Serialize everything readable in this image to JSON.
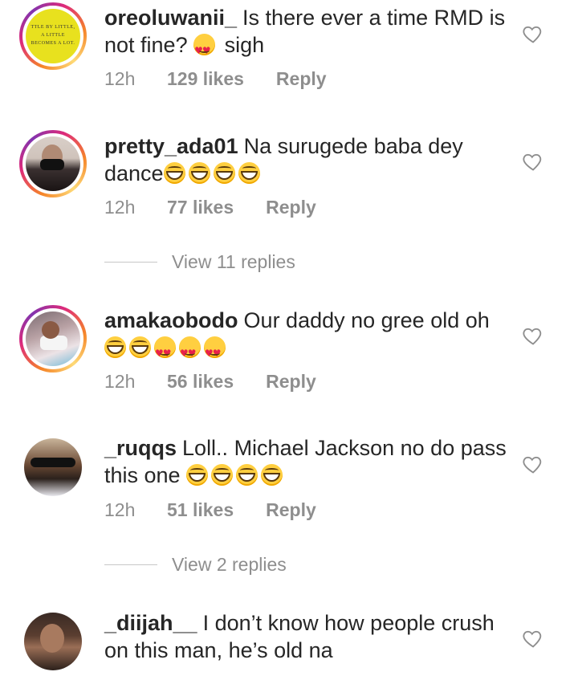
{
  "comments": [
    {
      "username": "oreoluwanii_",
      "text": "Is there ever a time RMD is not fine?",
      "text2": "sigh",
      "emojis": [
        "heart-eyes"
      ],
      "time": "12h",
      "likes": "129 likes",
      "reply": "Reply",
      "avatar_caption": [
        "TTLE BY LITTLE,",
        "A LITTLE",
        "BECOMES A LOT."
      ]
    },
    {
      "username": "pretty_ada01",
      "text": "Na surugede baba dey dance",
      "emojis": [
        "grin",
        "grin",
        "grin",
        "grin"
      ],
      "time": "12h",
      "likes": "77 likes",
      "reply": "Reply",
      "view_replies": "View 11 replies"
    },
    {
      "username": "amakaobodo",
      "text": "Our daddy no gree old oh",
      "emojis": [
        "grin",
        "grin",
        "heart-eyes",
        "heart-eyes",
        "heart-eyes"
      ],
      "time": "12h",
      "likes": "56 likes",
      "reply": "Reply"
    },
    {
      "username": "_ruqqs",
      "text": "Loll.. Michael Jackson no do pass this one",
      "emojis": [
        "grin",
        "grin",
        "grin",
        "grin"
      ],
      "time": "12h",
      "likes": "51 likes",
      "reply": "Reply",
      "view_replies": "View 2 replies"
    },
    {
      "username": "_diijah__",
      "text": "I don’t know how people crush on this man, he’s old na"
    }
  ],
  "icons": {
    "like": "heart-outline-icon",
    "emoji_grin": "grinning-squinting-face-icon",
    "emoji_heart": "heart-eyes-face-icon"
  },
  "colors": {
    "text": "#262626",
    "meta": "#8e8e8e",
    "ring_start": "#f58529",
    "ring_mid": "#dd2a7b",
    "ring_end": "#8134af"
  }
}
